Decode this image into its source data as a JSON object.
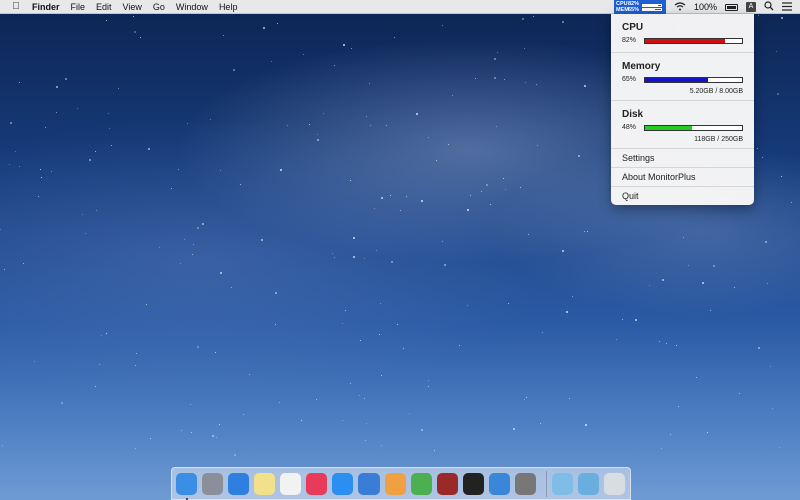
{
  "menubar": {
    "app_name": "Finder",
    "items": [
      "File",
      "Edit",
      "View",
      "Go",
      "Window",
      "Help"
    ],
    "status_widget": {
      "cpu_label": "CPU",
      "mem_label": "MEM",
      "cpu_value": "82%",
      "mem_value": "65%"
    },
    "battery_percent": "100%",
    "input_source": "A"
  },
  "dropdown": {
    "cpu": {
      "title": "CPU",
      "percent": "82%",
      "fraction": 0.82,
      "color": "#d01010"
    },
    "memory": {
      "title": "Memory",
      "percent": "65%",
      "fraction": 0.65,
      "color": "#1515c8",
      "detail": "5.20GB / 8.00GB"
    },
    "disk": {
      "title": "Disk",
      "percent": "48%",
      "fraction": 0.48,
      "color": "#22cc22",
      "detail": "118GB / 250GB"
    },
    "settings_label": "Settings",
    "about_label": "About MonitorPlus",
    "quit_label": "Quit"
  },
  "dock": {
    "apps": [
      {
        "name": "finder-icon",
        "color": "#3a8ee6",
        "running": true
      },
      {
        "name": "launchpad-icon",
        "color": "#8a8f99",
        "running": false
      },
      {
        "name": "safari-icon",
        "color": "#2f7fe0",
        "running": false
      },
      {
        "name": "notes-icon",
        "color": "#f3e08a",
        "running": false
      },
      {
        "name": "textedit-icon",
        "color": "#f2f2f2",
        "running": false
      },
      {
        "name": "itunes-icon",
        "color": "#e83a5a",
        "running": false
      },
      {
        "name": "app-store-icon",
        "color": "#2a8ff0",
        "running": false
      },
      {
        "name": "keynote-icon",
        "color": "#3a7dd6",
        "running": false
      },
      {
        "name": "pages-icon",
        "color": "#f0a040",
        "running": false
      },
      {
        "name": "numbers-icon",
        "color": "#4caf50",
        "running": false
      },
      {
        "name": "dictionary-icon",
        "color": "#9a2a2a",
        "running": false
      },
      {
        "name": "terminal-icon",
        "color": "#222222",
        "running": false
      },
      {
        "name": "xcode-icon",
        "color": "#3a86d8",
        "running": false
      },
      {
        "name": "system-preferences-icon",
        "color": "#777777",
        "running": false
      }
    ],
    "stacks": [
      {
        "name": "folder-icon",
        "color": "#7fbde8"
      },
      {
        "name": "downloads-icon",
        "color": "#6aaee0"
      },
      {
        "name": "trash-icon",
        "color": "#d8dde3"
      }
    ]
  }
}
